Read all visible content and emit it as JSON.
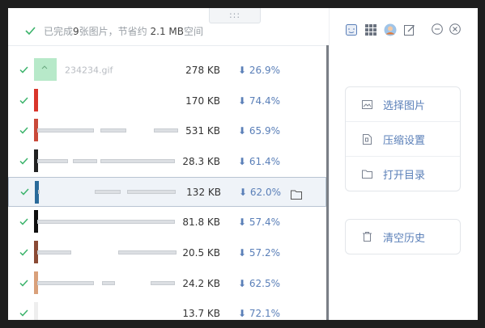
{
  "status": {
    "prefix": "已完成",
    "count": "9",
    "middle": "张图片，节省约",
    "saved": "2.1 MB",
    "suffix": "空间"
  },
  "drag_handle": ":::",
  "files": [
    {
      "name": "234234.gif",
      "size": "278 KB",
      "reduction": "26.9%",
      "thumb_color": "#b7e9c9"
    },
    {
      "name": "",
      "size": "170 KB",
      "reduction": "74.4%",
      "thumb_color": "#d9352b"
    },
    {
      "name": "",
      "size": "531 KB",
      "reduction": "65.9%",
      "thumb_color": "#c94a3a"
    },
    {
      "name": "",
      "size": "28.3 KB",
      "reduction": "61.4%",
      "thumb_color": "#222222"
    },
    {
      "name": "",
      "size": "132 KB",
      "reduction": "62.0%",
      "thumb_color": "#2a6a9a"
    },
    {
      "name": "",
      "size": "81.8 KB",
      "reduction": "57.4%",
      "thumb_color": "#0f0f0f"
    },
    {
      "name": "",
      "size": "20.5 KB",
      "reduction": "57.2%",
      "thumb_color": "#8a4a35"
    },
    {
      "name": "",
      "size": "24.2 KB",
      "reduction": "62.5%",
      "thumb_color": "#d9a07a"
    },
    {
      "name": "",
      "size": "13.7 KB",
      "reduction": "72.1%",
      "thumb_color": "#eeeeee"
    }
  ],
  "selected_index": 4,
  "sidebar": {
    "select_images": "选择图片",
    "compress_settings": "压缩设置",
    "open_directory": "打开目录",
    "clear_history": "清空历史"
  },
  "colors": {
    "accent": "#5a7fb8",
    "check": "#3bb36b",
    "selected_bg": "#eff3f8"
  }
}
